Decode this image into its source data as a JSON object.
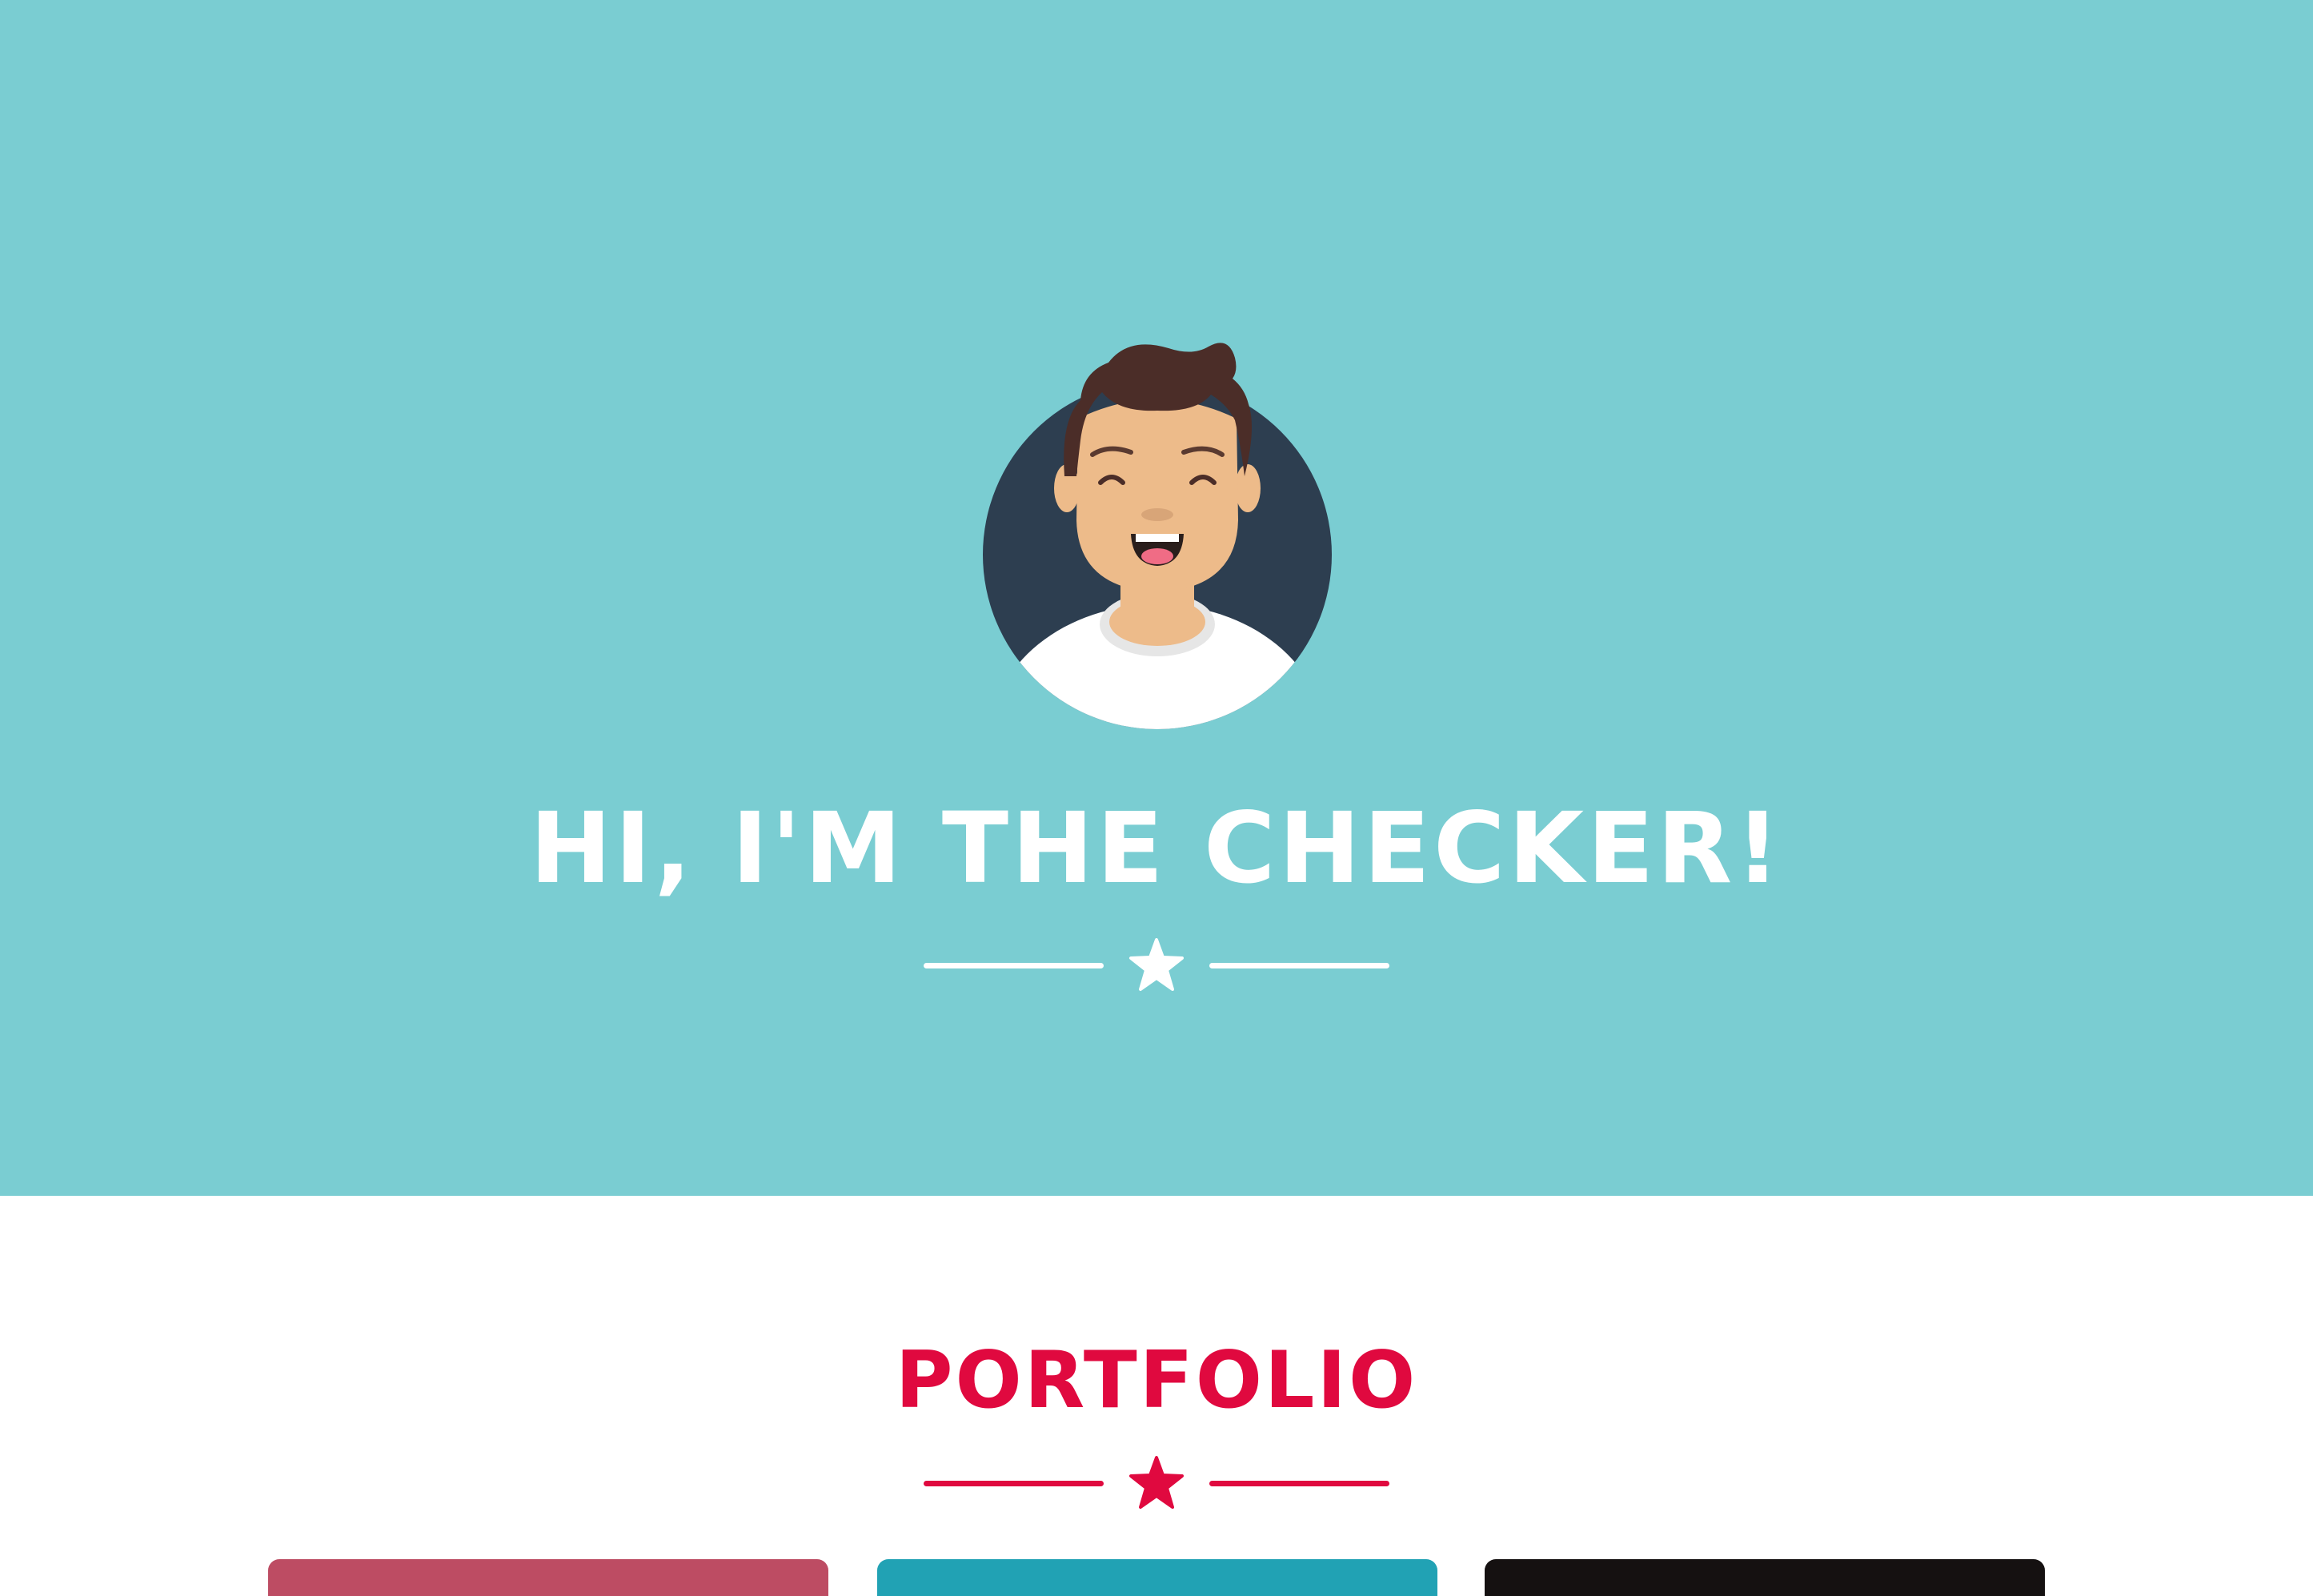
{
  "hero": {
    "background": "#7acdd2",
    "title": "HI, I'M THE CHECKER!",
    "avatar_icon": "smiling-man-avatar",
    "divider_icon": "star-icon"
  },
  "portfolio": {
    "title": "PORTFOLIO",
    "accent_color": "#e0093f",
    "divider_icon": "star-icon",
    "cards": [
      {
        "color": "#bd4c63"
      },
      {
        "color": "#21a2b4"
      },
      {
        "color": "#151111"
      }
    ]
  }
}
